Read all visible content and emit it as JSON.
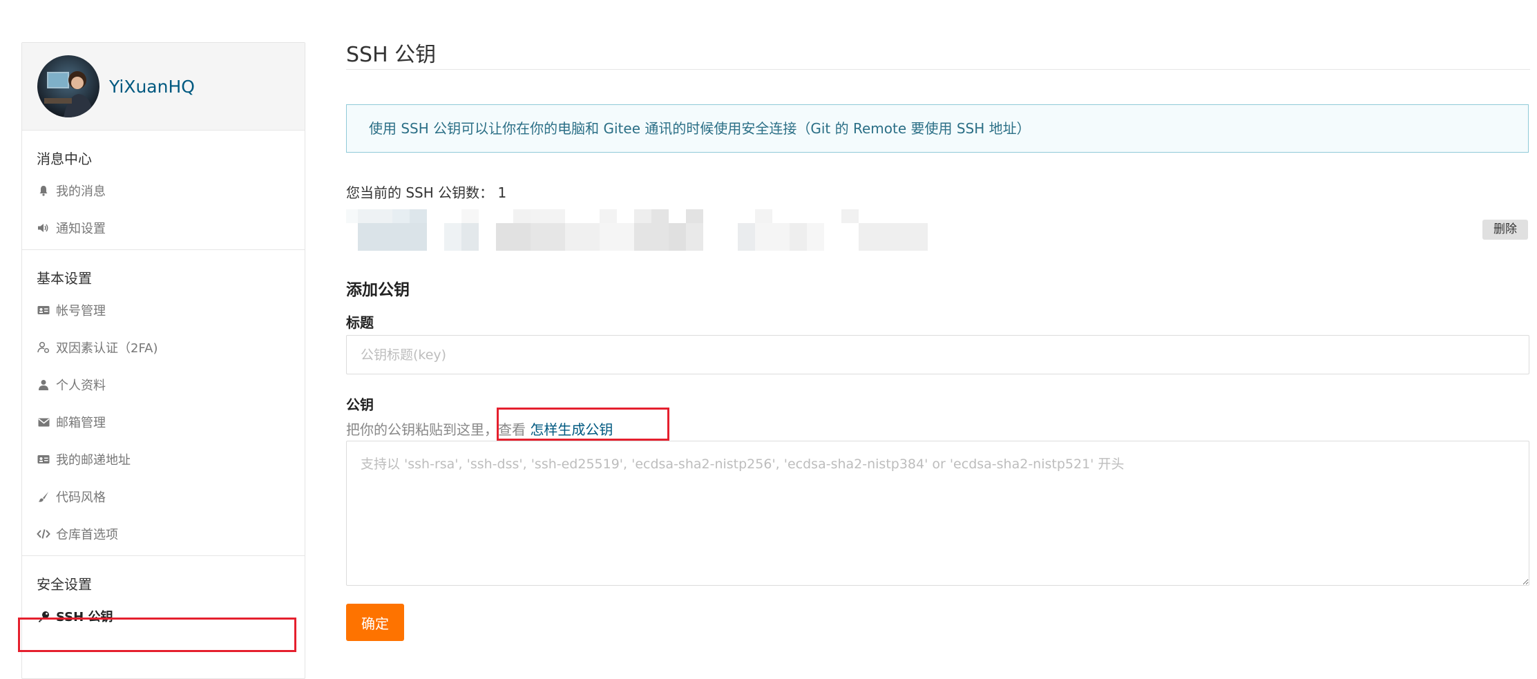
{
  "colors": {
    "accent": "#fe7300",
    "link": "#005980",
    "info_border": "#8fcad8",
    "info_bg": "#f4fbfd",
    "highlight_red": "#e5202e"
  },
  "sidebar": {
    "username": "YiXuanHQ",
    "groups": [
      {
        "title": "消息中心",
        "items": [
          {
            "label": "我的消息",
            "icon": "bell-icon"
          },
          {
            "label": "通知设置",
            "icon": "speaker-icon"
          }
        ]
      },
      {
        "title": "基本设置",
        "items": [
          {
            "label": "帐号管理",
            "icon": "id-card-icon"
          },
          {
            "label": "双因素认证（2FA)",
            "icon": "user-shield-icon"
          },
          {
            "label": "个人资料",
            "icon": "user-icon"
          },
          {
            "label": "邮箱管理",
            "icon": "envelope-icon"
          },
          {
            "label": "我的邮递地址",
            "icon": "address-card-icon"
          },
          {
            "label": "代码风格",
            "icon": "brush-icon"
          },
          {
            "label": "仓库首选项",
            "icon": "code-icon"
          }
        ]
      },
      {
        "title": "安全设置",
        "items": [
          {
            "label": "SSH 公钥",
            "icon": "key-icon",
            "active": true
          }
        ]
      }
    ]
  },
  "main": {
    "title": "SSH 公钥",
    "info": "使用 SSH 公钥可以让你在你的电脑和 Gitee 通讯的时候使用安全连接（Git 的 Remote 要使用 SSH 地址）",
    "key_count_label": "您当前的 SSH 公钥数：",
    "key_count": "1",
    "delete_label": "删除",
    "add_section_title": "添加公钥",
    "title_field": {
      "label": "标题",
      "placeholder": "公钥标题(key)"
    },
    "key_field": {
      "label": "公钥",
      "hint_prefix": "把你的公钥粘贴到这里，查看 ",
      "hint_link": "怎样生成公钥",
      "placeholder": "支持以 'ssh-rsa', 'ssh-dss', 'ssh-ed25519', 'ecdsa-sha2-nistp256', 'ecdsa-sha2-nistp384' or 'ecdsa-sha2-nistp521' 开头"
    },
    "submit_label": "确定"
  }
}
